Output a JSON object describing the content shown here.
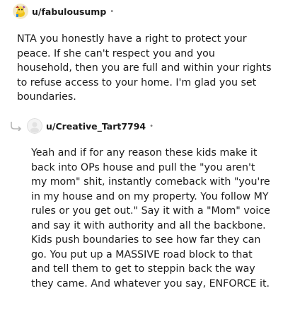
{
  "comments": [
    {
      "username": "u/fabulousump",
      "separator": "•",
      "avatar_icon": "snoo-avatar-icon",
      "text": "NTA you honestly have a right to protect your peace. If she can't respect you and you household, then you are full and within your rights to refuse access to your home. I'm glad you set boundaries."
    },
    {
      "username": "u/Creative_Tart7794",
      "separator": "•",
      "avatar_icon": "default-avatar-icon",
      "reply_icon": "reply-arrow-icon",
      "text": "Yeah and if for any reason these kids make it back into OPs house and pull the \"you aren't my mom\" shit, instantly comeback with \"you're in my house and on my property. You follow MY rules or you get out.\" Say it with a \"Mom\" voice and say it with authority and all the backbone. Kids push boundaries to see how far they can go. You put up a MASSIVE road block to that and tell them to get to steppin back the way they came. And whatever you say, ENFORCE it."
    }
  ],
  "colors": {
    "text": "#1c1c1c",
    "meta": "#7c7c7c",
    "thread_line": "#d0d0d0"
  }
}
